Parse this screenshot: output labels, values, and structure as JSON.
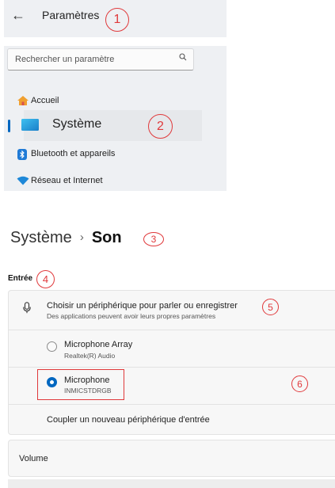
{
  "header": {
    "title": "Paramètres"
  },
  "search": {
    "placeholder": "Rechercher un paramètre"
  },
  "nav": {
    "items": [
      {
        "label": "Accueil",
        "icon": "home-icon"
      },
      {
        "label": "Système",
        "icon": "system-display-icon",
        "selected": true
      },
      {
        "label": "Bluetooth et appareils",
        "icon": "bluetooth-icon"
      },
      {
        "label": "Réseau et Internet",
        "icon": "wifi-icon"
      }
    ]
  },
  "breadcrumb": {
    "parent": "Système",
    "separator": "›",
    "current": "Son"
  },
  "input_section": {
    "label": "Entrée",
    "chooser": {
      "title": "Choisir un périphérique pour parler ou enregistrer",
      "subtitle": "Des applications peuvent avoir leurs propres paramètres"
    },
    "devices": [
      {
        "name": "Microphone Array",
        "detail": "Realtek(R) Audio",
        "selected": false
      },
      {
        "name": "Microphone",
        "detail": "INMICSTDRGB",
        "selected": true
      }
    ],
    "pair_label": "Coupler un nouveau périphérique d'entrée"
  },
  "volume": {
    "label": "Volume"
  },
  "annotations": [
    "1",
    "2",
    "3",
    "4",
    "5",
    "6"
  ],
  "colors": {
    "accent": "#0067c0",
    "annotation": "#e0393b",
    "panel": "#eef0f3"
  }
}
